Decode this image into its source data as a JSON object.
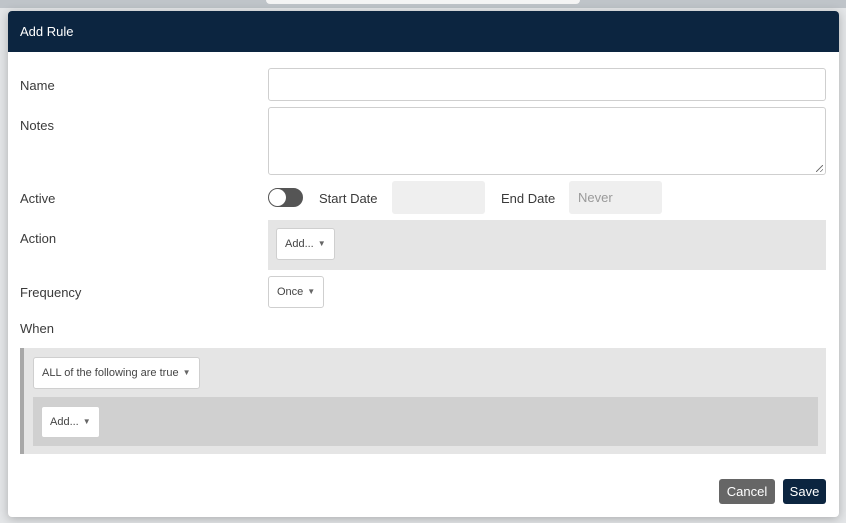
{
  "modal": {
    "title": "Add Rule",
    "name_label": "Name",
    "name_value": "",
    "notes_label": "Notes",
    "notes_value": "",
    "active_label": "Active",
    "active_on": false,
    "start_date_label": "Start Date",
    "start_date_value": "",
    "end_date_label": "End Date",
    "end_date_placeholder": "Never",
    "action_label": "Action",
    "action_add": "Add...",
    "frequency_label": "Frequency",
    "frequency_value": "Once",
    "when_label": "When",
    "condition_mode": "ALL of the following are true",
    "condition_add": "Add...",
    "cancel_label": "Cancel",
    "save_label": "Save"
  },
  "colors": {
    "header": "#0c2540",
    "cancel": "#666666",
    "save": "#0c2540"
  }
}
